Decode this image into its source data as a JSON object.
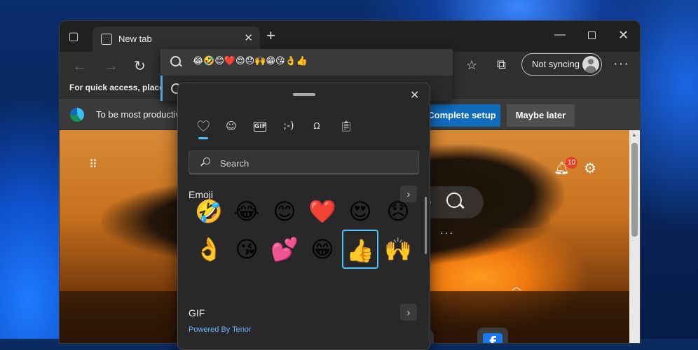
{
  "tab": {
    "title": "New tab"
  },
  "toolbar": {
    "sync_label": "Not syncing"
  },
  "favbar": {
    "text": "For quick access, place y"
  },
  "infobar": {
    "text": "To be most productiv",
    "complete_label": "Complete setup",
    "later_label": "Maybe later"
  },
  "omnibox": {
    "value": "😂🤣😊❤️😍😞🙌😁😘👌👍"
  },
  "page": {
    "notification_count": "10"
  },
  "emoji_panel": {
    "search_placeholder": "Search",
    "emoji_section": "Emoji",
    "gif_section": "GIF",
    "powered_by": "Powered By Tenor",
    "tabs": [
      "heart-emoji-tab",
      "smiley-tab",
      "GIF",
      "tab-kaomoji",
      ";-)",
      "symbols-tab",
      "clipboard-tab"
    ],
    "emojis_row1": [
      "🤣",
      "😂",
      "😊",
      "❤️",
      "😍",
      "😞"
    ],
    "emojis_row2": [
      "👌",
      "😘",
      "💕",
      "😁",
      "👍",
      "🙌"
    ],
    "selected_emoji": "👍"
  },
  "colors": {
    "accent": "#4cc2ff",
    "primary_button": "#0f6cbd",
    "badge": "#e8412b"
  }
}
